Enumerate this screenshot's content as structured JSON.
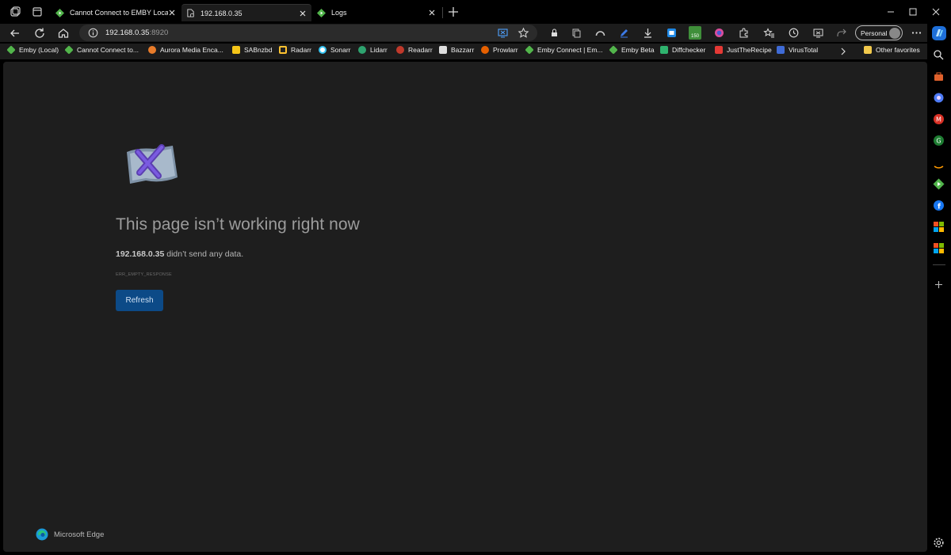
{
  "colors": {
    "accent_blue": "#0c4a87",
    "emby_green": "#52b54b",
    "page_bg": "#1e1e1e",
    "chrome_bg": "#1c1c1c"
  },
  "tabs": [
    {
      "label": "Cannot Connect to EMBY Local or",
      "icon": "emby-icon"
    },
    {
      "label": "192.168.0.35",
      "icon": "page-error-icon",
      "active": true
    },
    {
      "label": "Logs",
      "icon": "emby-icon"
    }
  ],
  "address": {
    "host": "192.168.0.35",
    "port": ":8920"
  },
  "profile": {
    "label": "Personal"
  },
  "bookmarks": [
    {
      "label": "Emby (Local)",
      "icon": "emby-icon",
      "color": "#52b54b"
    },
    {
      "label": "Cannot Connect to...",
      "icon": "emby-icon",
      "color": "#52b54b"
    },
    {
      "label": "Aurora Media Enca...",
      "icon": "aurora-icon",
      "color": "#e87b2a"
    },
    {
      "label": "SABnzbd",
      "icon": "sabnzbd-icon",
      "color": "#f5c518"
    },
    {
      "label": "Radarr",
      "icon": "radarr-icon",
      "color": "#ffc230"
    },
    {
      "label": "Sonarr",
      "icon": "sonarr-icon",
      "color": "#35c5f4"
    },
    {
      "label": "Lidarr",
      "icon": "lidarr-icon",
      "color": "#2ea36f"
    },
    {
      "label": "Readarr",
      "icon": "readarr-icon",
      "color": "#c0392b"
    },
    {
      "label": "Bazzarr",
      "icon": "bazarr-icon",
      "color": "#dddddd"
    },
    {
      "label": "Prowlarr",
      "icon": "prowlarr-icon",
      "color": "#e66000"
    },
    {
      "label": "Emby Connect | Em...",
      "icon": "emby-icon",
      "color": "#52b54b"
    },
    {
      "label": "Emby Beta",
      "icon": "emby-icon",
      "color": "#52b54b"
    },
    {
      "label": "Diffchecker",
      "icon": "diffchecker-icon",
      "color": "#2fb36e"
    },
    {
      "label": "JustTheRecipe",
      "icon": "recipe-icon",
      "color": "#e53935"
    },
    {
      "label": "VirusTotal",
      "icon": "virustotal-icon",
      "color": "#3f6bd6"
    },
    {
      "label": "Other favorites",
      "icon": "folder-icon",
      "color": "#f2c94c"
    }
  ],
  "error": {
    "title": "This page isn’t working right now",
    "host": "192.168.0.35",
    "desc_rest": " didn’t send any data.",
    "code": "ERR_EMPTY_RESPONSE",
    "refresh_label": "Refresh"
  },
  "brand": {
    "label": "Microsoft Edge"
  },
  "extension_badge": "150"
}
